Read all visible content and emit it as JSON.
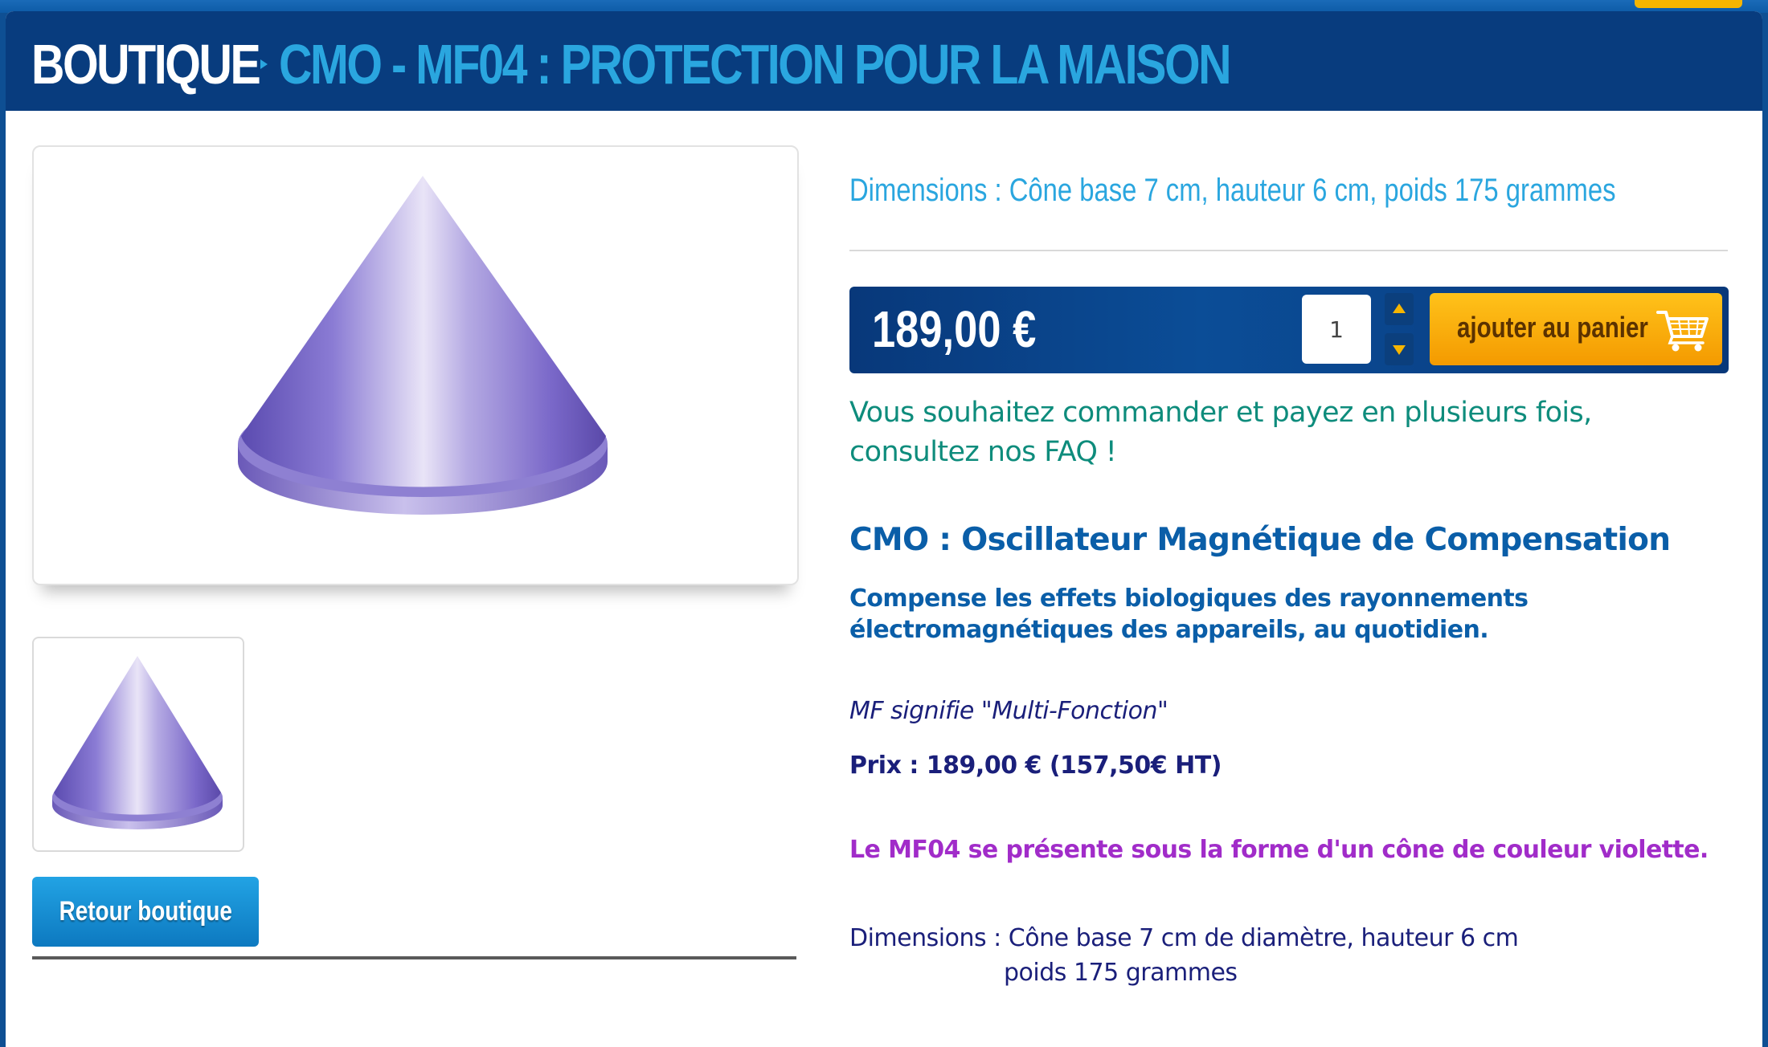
{
  "header": {
    "breadcrumb_root": "BOUTIQUE",
    "page_title": "CMO - MF04 : PROTECTION POUR LA MAISON"
  },
  "product": {
    "image_icon": "purple-cone-product-image",
    "thumbnail_icon": "purple-cone-thumbnail",
    "back_button_label": "Retour boutique",
    "dimensions_summary": "Dimensions : Cône base 7 cm, hauteur 6 cm, poids 175 grammes",
    "price": "189,00 €",
    "quantity": "1",
    "add_to_cart_label": "ajouter au panier",
    "cart_icon": "shopping-cart-icon",
    "faq_text": "Vous souhaitez commander et payez en plusieurs fois, consultez nos FAQ !",
    "heading": "CMO : Oscillateur Magnétique de Compensation",
    "lead": "Compense les effets biologiques des rayonnements électromagnétiques des appareils, au quotidien.",
    "mf_note": "MF signifie \"Multi-Fonction\"",
    "price_detail": "Prix : 189,00 € (157,50€ HT)",
    "color_note": "Le MF04 se présente sous la forme d'un cône de couleur violette.",
    "dimensions_line1": "Dimensions : Cône base 7 cm de diamètre, hauteur 6 cm",
    "dimensions_line2": "poids 175 grammes"
  },
  "colors": {
    "header_bg": "#083c7e",
    "title_accent": "#2aa6df",
    "cart_button": "#f6b500",
    "faq_text": "#0e8c7c",
    "heading": "#0a5ea8",
    "violet_note": "#a12cc9"
  }
}
